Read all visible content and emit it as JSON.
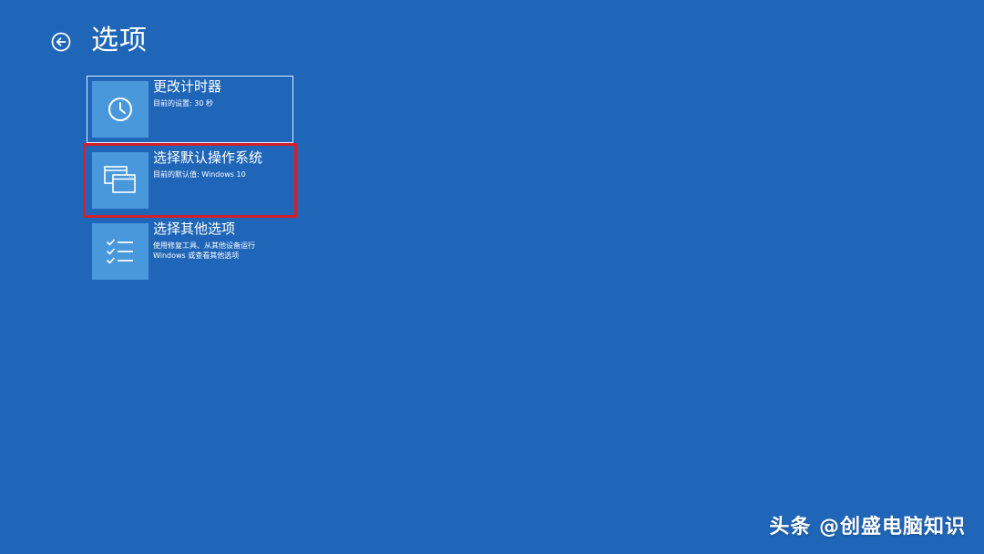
{
  "page": {
    "title": "选项",
    "back_icon": "back-arrow-icon"
  },
  "options": [
    {
      "title": "更改计时器",
      "subtitle": "目前的设置: 30 秒",
      "icon": "clock-icon"
    },
    {
      "title": "选择默认操作系统",
      "subtitle": "目前的默认值: Windows 10",
      "icon": "windows-stack-icon"
    },
    {
      "title": "选择其他选项",
      "subtitle": "使用修复工具、从其他设备运行\nWindows 或查看其他选项",
      "icon": "checklist-icon"
    }
  ],
  "watermark": {
    "text": "头条 @创盛电脑知识"
  },
  "colors": {
    "background": "#1f66b8",
    "tile_icon_bg": "#4a98dc",
    "focus_border": "#e4ecf7",
    "highlight_outline": "#d3212c",
    "text": "#ffffff"
  }
}
